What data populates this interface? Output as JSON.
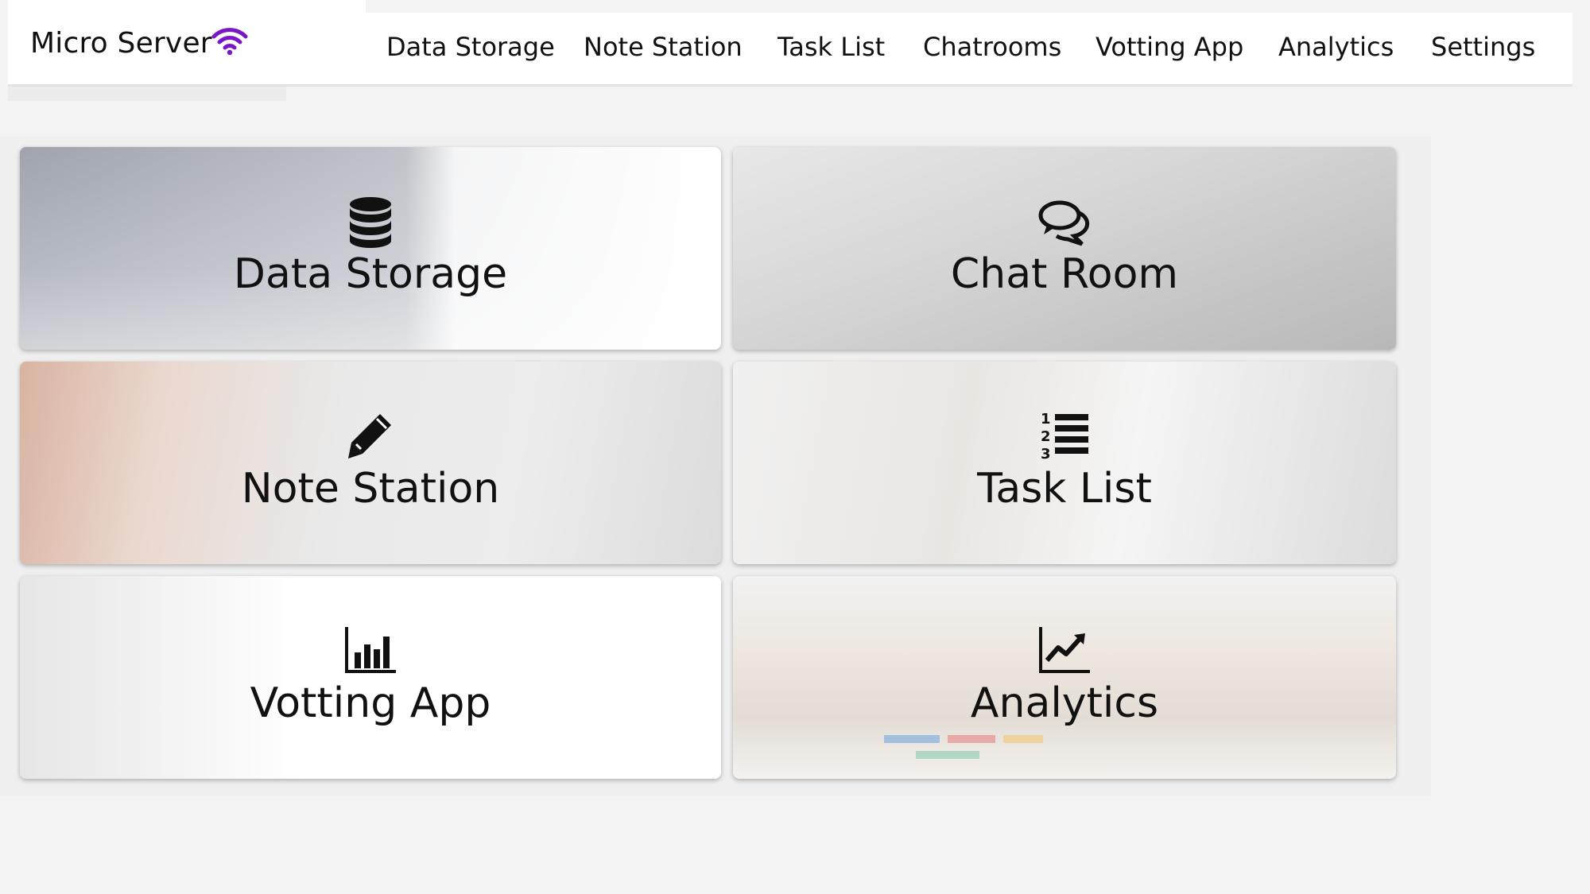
{
  "brand": {
    "title": "Micro Server",
    "icon": "wifi-icon",
    "icon_color": "#7a16c9"
  },
  "nav": {
    "items": [
      {
        "label": "Data Storage"
      },
      {
        "label": "Note Station"
      },
      {
        "label": "Task List"
      },
      {
        "label": "Chatrooms"
      },
      {
        "label": "Votting App"
      },
      {
        "label": "Analytics"
      },
      {
        "label": "Settings"
      }
    ]
  },
  "cards": {
    "data_storage": {
      "label": "Data Storage",
      "icon": "database-icon"
    },
    "chat_room": {
      "label": "Chat Room",
      "icon": "chat-bubbles-icon"
    },
    "note_station": {
      "label": "Note Station",
      "icon": "pencil-icon"
    },
    "task_list": {
      "label": "Task List",
      "icon": "numbered-list-icon"
    },
    "voting_app": {
      "label": "Votting App",
      "icon": "bar-chart-icon"
    },
    "analytics": {
      "label": "Analytics",
      "icon": "line-chart-icon"
    }
  },
  "colors": {
    "page_bg": "#f3f3f3",
    "header_bg": "#ffffff",
    "text": "#111111"
  }
}
